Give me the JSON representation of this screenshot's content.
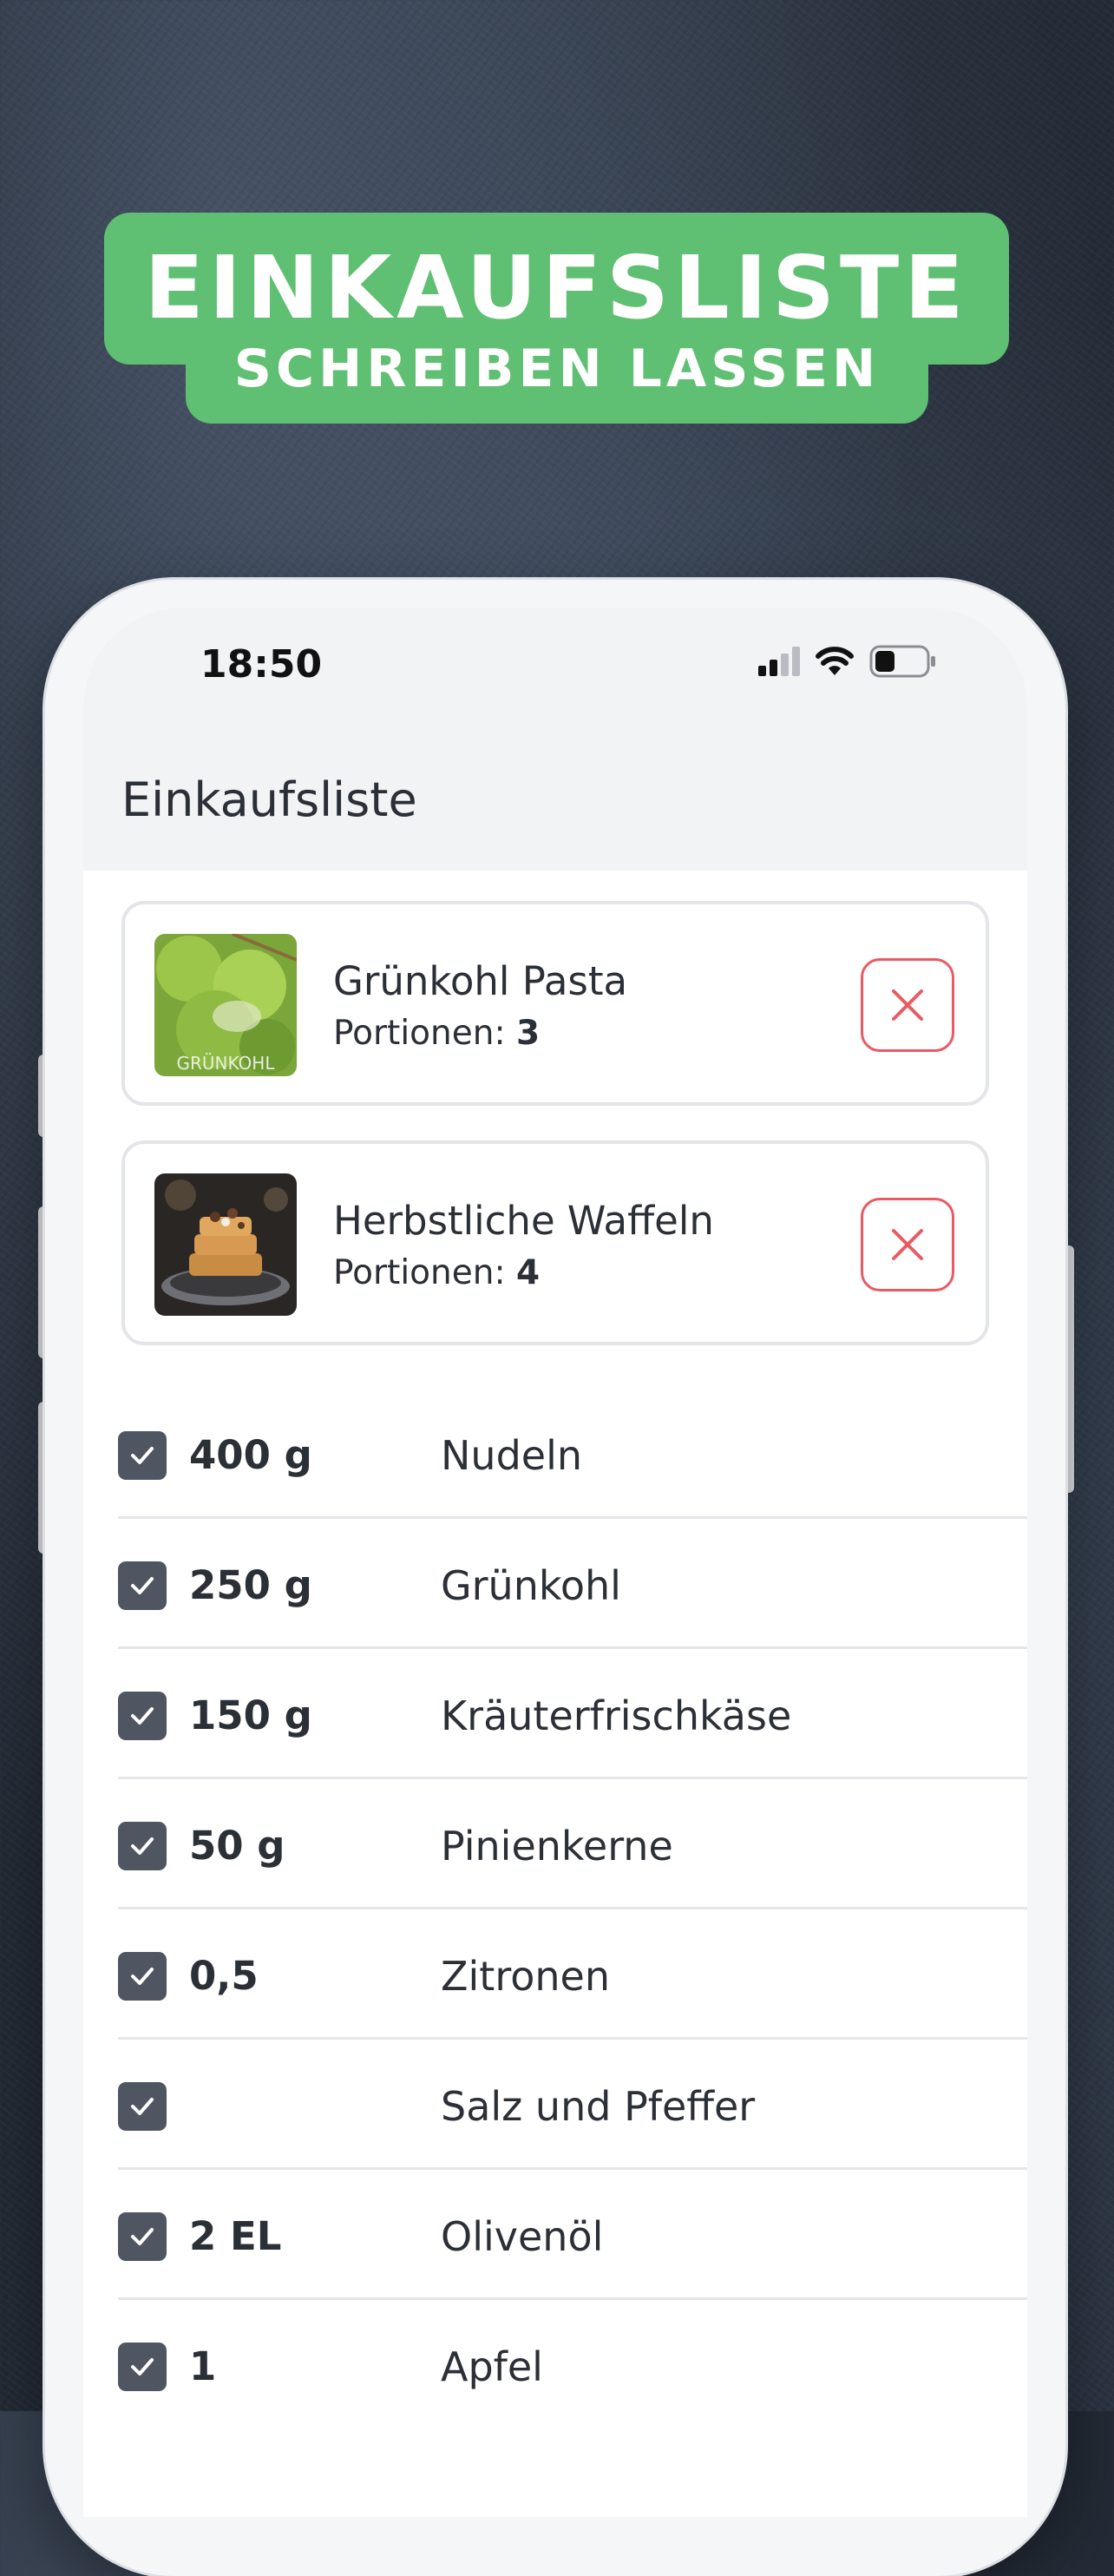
{
  "banner": {
    "line1": "EINKAUFSLISTE",
    "line2": "SCHREIBEN LASSEN"
  },
  "status_bar": {
    "time": "18:50",
    "icons": [
      "signal-icon",
      "wifi-icon",
      "battery-icon"
    ]
  },
  "header": {
    "title": "Einkaufsliste"
  },
  "recipes": [
    {
      "name": "Grünkohl Pasta",
      "portions_label": "Portionen:",
      "portions": "3",
      "thumb_caption": "GRÜNKOHL",
      "remove_icon": "close-icon"
    },
    {
      "name": "Herbstliche Waffeln",
      "portions_label": "Portionen:",
      "portions": "4",
      "remove_icon": "close-icon"
    }
  ],
  "ingredients": [
    {
      "amount": "400 g",
      "name": "Nudeln",
      "checked": true
    },
    {
      "amount": "250 g",
      "name": "Grünkohl",
      "checked": true
    },
    {
      "amount": "150 g",
      "name": "Kräuterfrischkäse",
      "checked": true
    },
    {
      "amount": "50 g",
      "name": "Pinienkerne",
      "checked": true
    },
    {
      "amount": "0,5",
      "name": "Zitronen",
      "checked": true
    },
    {
      "amount": "",
      "name": "Salz und Pfeffer",
      "checked": true
    },
    {
      "amount": "2 EL",
      "name": "Olivenöl",
      "checked": true
    },
    {
      "amount": "1",
      "name": "Apfel",
      "checked": true
    }
  ],
  "colors": {
    "banner_green": "#5fbf72",
    "checkbox": "#4f5661",
    "remove_red": "#ea5a62",
    "header_bg": "#f1f3f5"
  }
}
